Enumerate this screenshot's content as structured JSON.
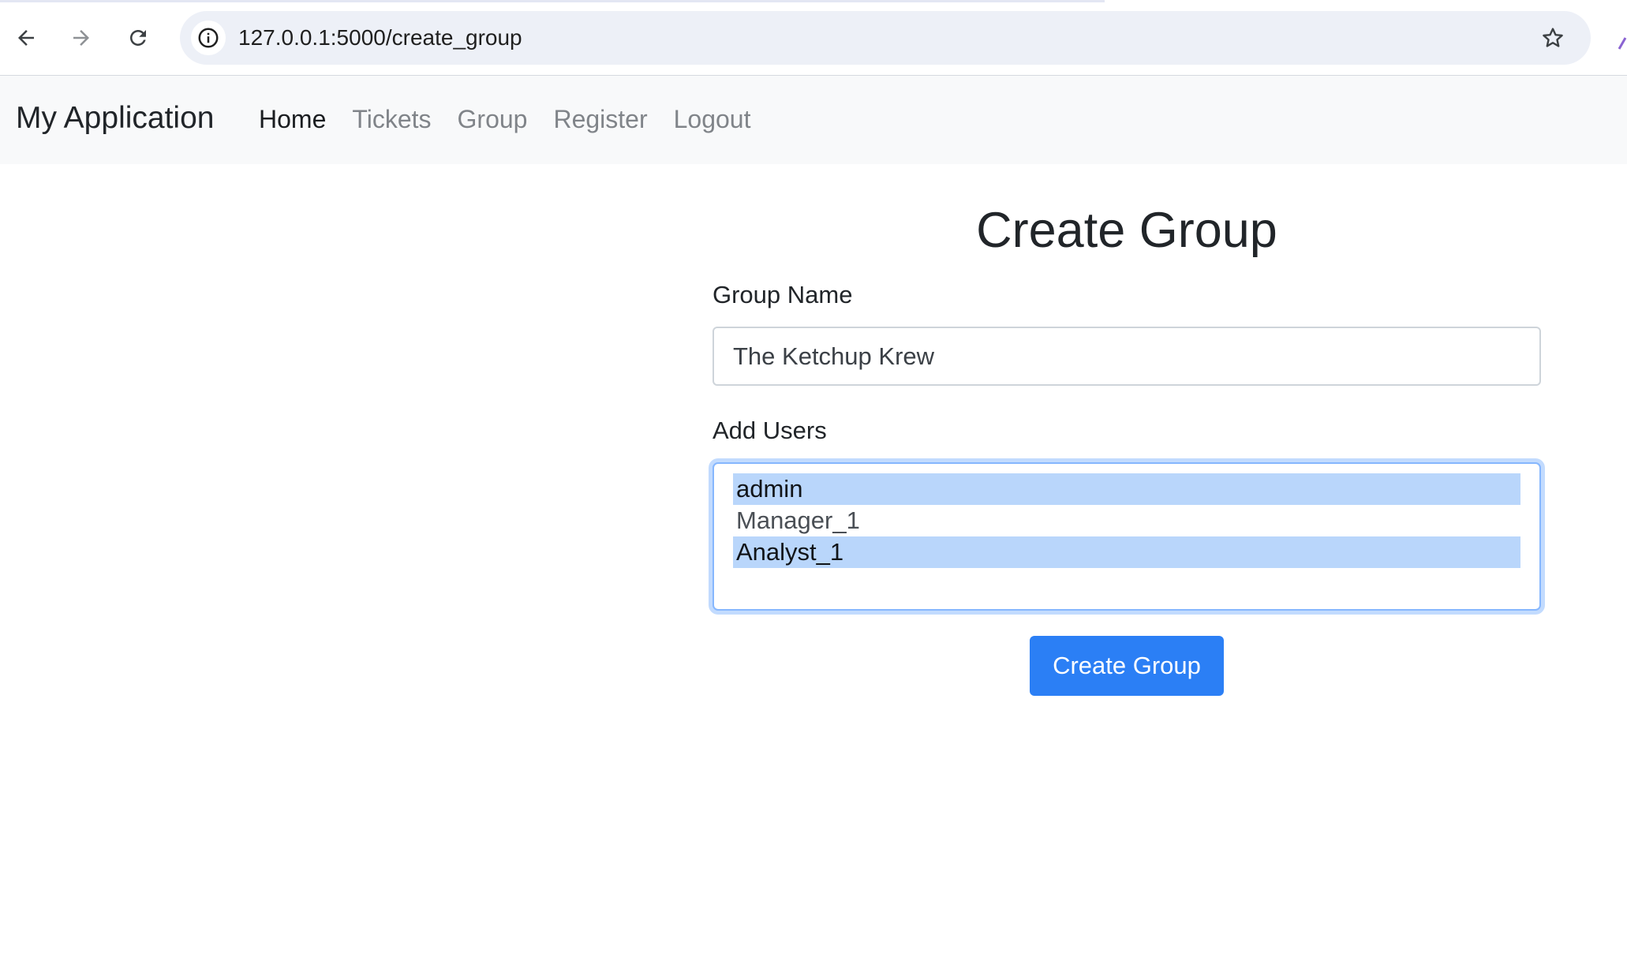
{
  "browser": {
    "url": "127.0.0.1:5000/create_group",
    "icons": {
      "back": "arrow-left-icon",
      "forward": "arrow-right-icon",
      "reload": "reload-icon",
      "site_info": "info-icon",
      "bookmark": "star-icon"
    }
  },
  "navbar": {
    "brand": "My Application",
    "links": [
      {
        "label": "Home",
        "active": true
      },
      {
        "label": "Tickets",
        "active": false
      },
      {
        "label": "Group",
        "active": false
      },
      {
        "label": "Register",
        "active": false
      },
      {
        "label": "Logout",
        "active": false
      }
    ]
  },
  "form": {
    "title": "Create Group",
    "group_name_label": "Group Name",
    "group_name_value": "The Ketchup Krew",
    "add_users_label": "Add Users",
    "users": [
      {
        "label": "admin",
        "selected": true
      },
      {
        "label": "Manager_1",
        "selected": false
      },
      {
        "label": "Analyst_1",
        "selected": true
      }
    ],
    "submit_label": "Create Group"
  },
  "colors": {
    "primary_button": "#2b7ff5",
    "selected_option": "#b9d6fb",
    "focus_border": "#86b7fe",
    "navbar_background": "#f8f9fa",
    "omnibox_background": "#edf0f7"
  }
}
